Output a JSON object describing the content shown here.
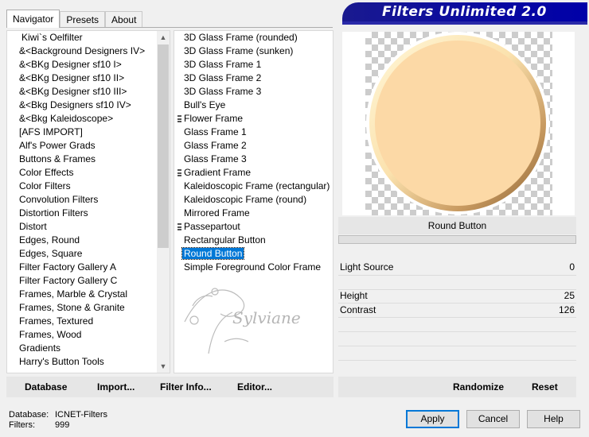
{
  "tabs": [
    "Navigator",
    "Presets",
    "About"
  ],
  "banner_title": "Filters Unlimited 2.0",
  "categories": [
    "Kiwi`s Oelfilter",
    "&<Background Designers IV>",
    "&<BKg Designer sf10 I>",
    "&<BKg Designer sf10 II>",
    "&<BKg Designer sf10 III>",
    "&<Bkg Designers sf10 IV>",
    "&<Bkg Kaleidoscope>",
    "[AFS IMPORT]",
    "Alf's Power Grads",
    "Buttons & Frames",
    "Color Effects",
    "Color Filters",
    "Convolution Filters",
    "Distortion Filters",
    "Distort",
    "Edges, Round",
    "Edges, Square",
    "Filter Factory Gallery A",
    "Filter Factory Gallery C",
    "Frames, Marble & Crystal",
    "Frames, Stone & Granite",
    "Frames, Textured",
    "Frames, Wood",
    "Gradients",
    "Harry's Button Tools"
  ],
  "filters": [
    {
      "name": "3D Glass Frame (rounded)",
      "marked": false,
      "selected": false
    },
    {
      "name": "3D Glass Frame (sunken)",
      "marked": false,
      "selected": false
    },
    {
      "name": "3D Glass Frame 1",
      "marked": false,
      "selected": false
    },
    {
      "name": "3D Glass Frame 2",
      "marked": false,
      "selected": false
    },
    {
      "name": "3D Glass Frame 3",
      "marked": false,
      "selected": false
    },
    {
      "name": "Bull's Eye",
      "marked": false,
      "selected": false
    },
    {
      "name": "Flower Frame",
      "marked": true,
      "selected": false
    },
    {
      "name": "Glass Frame 1",
      "marked": false,
      "selected": false
    },
    {
      "name": "Glass Frame 2",
      "marked": false,
      "selected": false
    },
    {
      "name": "Glass Frame 3",
      "marked": false,
      "selected": false
    },
    {
      "name": "Gradient Frame",
      "marked": true,
      "selected": false
    },
    {
      "name": "Kaleidoscopic Frame (rectangular)",
      "marked": false,
      "selected": false
    },
    {
      "name": "Kaleidoscopic Frame (round)",
      "marked": false,
      "selected": false
    },
    {
      "name": "Mirrored Frame",
      "marked": false,
      "selected": false
    },
    {
      "name": "Passepartout",
      "marked": true,
      "selected": false
    },
    {
      "name": "Rectangular Button",
      "marked": false,
      "selected": false
    },
    {
      "name": "Round Button",
      "marked": false,
      "selected": true
    },
    {
      "name": "Simple Foreground Color Frame",
      "marked": false,
      "selected": false
    }
  ],
  "watermark_text": "Sylviane",
  "current_filter": "Round Button",
  "controls": [
    {
      "label": "Light Source",
      "value": "0"
    },
    {
      "label": "Height",
      "value": "25"
    },
    {
      "label": "Contrast",
      "value": "126"
    }
  ],
  "left_buttons": {
    "database": "Database",
    "import": "Import...",
    "filter_info": "Filter Info...",
    "editor": "Editor..."
  },
  "right_buttons": {
    "randomize": "Randomize",
    "reset": "Reset"
  },
  "status": {
    "database_label": "Database:",
    "database_value": "ICNET-Filters",
    "filters_label": "Filters:",
    "filters_value": "999"
  },
  "dialog_buttons": {
    "apply": "Apply",
    "cancel": "Cancel",
    "help": "Help"
  },
  "colors": {
    "accent": "#0078d7",
    "banner": "#0000a8",
    "button_fill": "#fcd9a6"
  }
}
